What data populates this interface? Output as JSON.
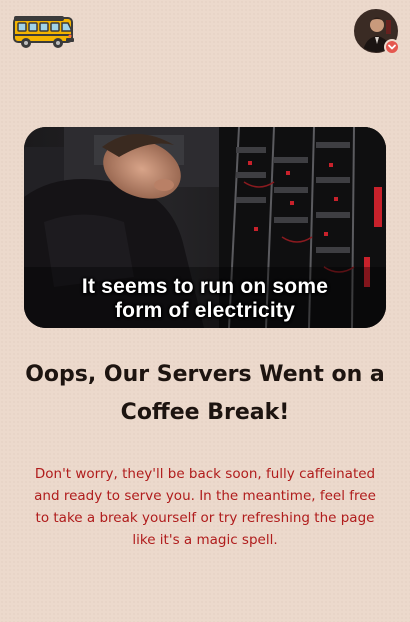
{
  "header": {
    "logo_icon": "school-bus-icon",
    "avatar_icon": "user-avatar",
    "avatar_badge_icon": "chevron-down-icon",
    "colors": {
      "bus_body": "#f4b400",
      "bus_dark": "#3b3b3b",
      "badge": "#e4574f"
    }
  },
  "error_gif": {
    "caption_line1": "It seems to run on some",
    "caption_line2": "form of electricity"
  },
  "error": {
    "title_line1": "Oops, Our Servers Went on a",
    "title_line2": "Coffee Break!",
    "description": "Don't worry, they'll be back soon, fully caffeinated and ready to serve you. In the meantime, feel free to take a break yourself or try refreshing the page like it's a magic spell."
  },
  "colors": {
    "background": "#ecd9cc",
    "title": "#1d1410",
    "description": "#b01c1c"
  }
}
